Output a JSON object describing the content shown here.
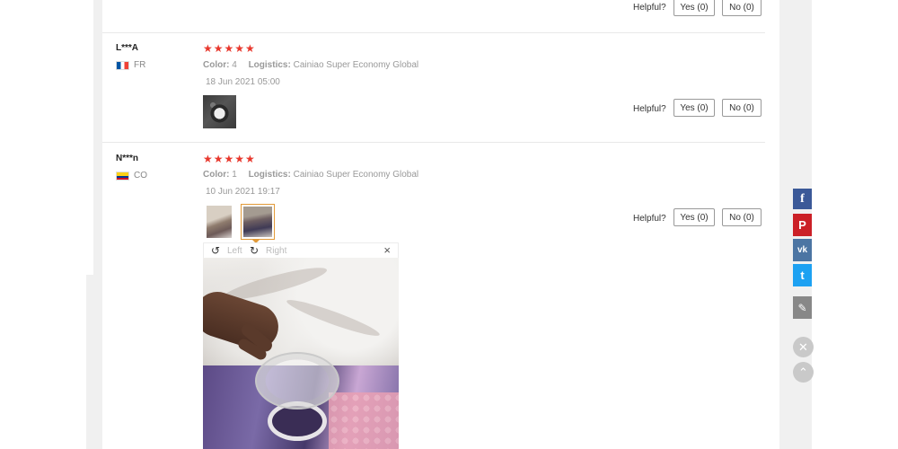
{
  "review_top": {
    "helpful_label": "Helpful?",
    "yes_label": "Yes (0)",
    "no_label": "No (0)"
  },
  "reviews": [
    {
      "name": "L***A",
      "country": "FR",
      "stars": "★★★★★",
      "color_label": "Color:",
      "color_value": "4",
      "logistics_label": "Logistics:",
      "logistics_value": "Cainiao Super Economy Global",
      "date": "18 Jun 2021 05:00",
      "helpful_label": "Helpful?",
      "yes_label": "Yes (0)",
      "no_label": "No (0)"
    },
    {
      "name": "N***n",
      "country": "CO",
      "stars": "★★★★★",
      "color_label": "Color:",
      "color_value": "1",
      "logistics_label": "Logistics:",
      "logistics_value": "Cainiao Super Economy Global",
      "date": "10 Jun 2021 19:17",
      "helpful_label": "Helpful?",
      "yes_label": "Yes (0)",
      "no_label": "No (0)"
    }
  ],
  "image_viewer": {
    "rotate_left_label": "Left",
    "rotate_right_label": "Right",
    "close_symbol": "×"
  },
  "share_bar": {
    "facebook": "f",
    "pinterest": "P",
    "vk": "vk",
    "twitter": "t",
    "edit": "✎",
    "close": "✕",
    "up": "⌃"
  },
  "colors": {
    "star": "#e8382d",
    "facebook": "#3b5998",
    "pinterest": "#cb2027",
    "vk": "#4c75a3",
    "twitter": "#1da1f2",
    "edit": "#888888",
    "thumb_active_border": "#e29a38"
  }
}
